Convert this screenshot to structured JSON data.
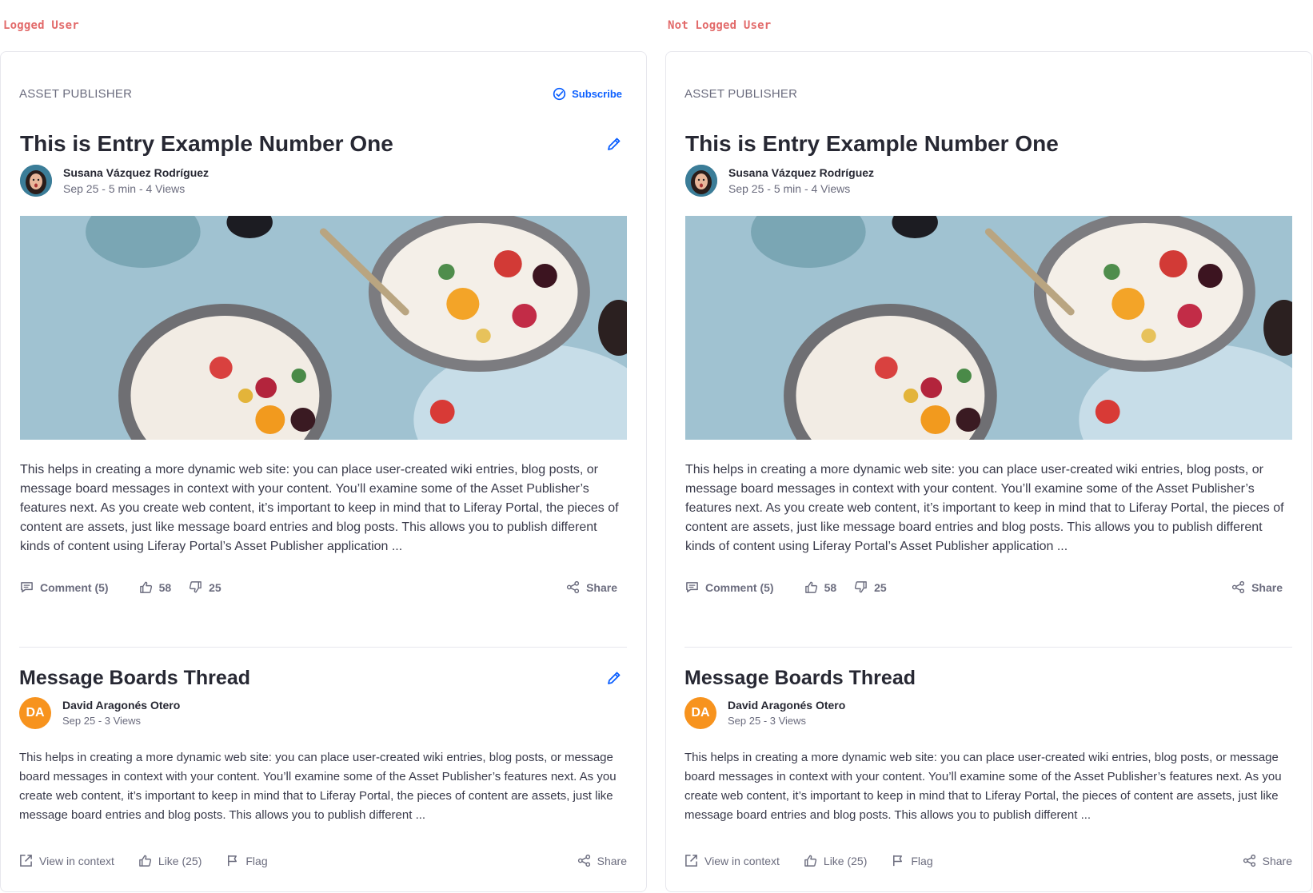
{
  "columns": [
    {
      "tag": "Logged User",
      "card_label": "ASSET PUBLISHER",
      "subscribe_label": "Subscribe",
      "entry": {
        "title": "This is Entry Example Number One",
        "author": "Susana Vázquez Rodríguez",
        "meta": "Sep 25 - 5 min - 4 Views",
        "excerpt": "This helps in creating a more dynamic web site: you can place user-created wiki entries, blog posts, or message board messages in context with your content. You’ll examine some of the Asset Publisher’s features next. As you create web content, it’s important to keep in mind that to Liferay Portal, the pieces of content are assets, just like message board entries and blog posts. This allows you to publish different kinds of content using Liferay Portal’s Asset Publisher application ...",
        "comment_label": "Comment (5)",
        "likes": "58",
        "dislikes": "25",
        "share_label": "Share"
      },
      "thread": {
        "title": "Message Boards Thread",
        "author_initials": "DA",
        "author": "David Aragonés Otero",
        "meta": "Sep 25  -  3 Views",
        "excerpt": "This helps in creating a more dynamic web site: you can place user-created wiki entries, blog posts, or message board messages in context with your content. You’ll examine some of the Asset Publisher’s features next. As you create web content, it’s important to keep in mind that to Liferay Portal, the pieces of content are assets, just like message board entries and blog posts. This allows you to publish different ...",
        "view_label": "View in context",
        "like_label": "Like (25)",
        "flag_label": "Flag",
        "share_label": "Share"
      }
    },
    {
      "tag": "Not Logged User",
      "card_label": "ASSET PUBLISHER",
      "entry": {
        "title": "This is Entry Example Number One",
        "author": "Susana Vázquez Rodríguez",
        "meta": "Sep 25 - 5 min - 4 Views",
        "excerpt": "This helps in creating a more dynamic web site: you can place user-created wiki entries, blog posts, or message board messages in context with your content. You’ll examine some of the Asset Publisher’s features next. As you create web content, it’s important to keep in mind that to Liferay Portal, the pieces of content are assets, just like message board entries and blog posts. This allows you to publish different kinds of content using Liferay Portal’s Asset Publisher application ...",
        "comment_label": "Comment (5)",
        "likes": "58",
        "dislikes": "25",
        "share_label": "Share"
      },
      "thread": {
        "title": "Message Boards Thread",
        "author_initials": "DA",
        "author": "David Aragonés Otero",
        "meta": "Sep 25  -  3 Views",
        "excerpt": "This helps in creating a more dynamic web site: you can place user-created wiki entries, blog posts, or message board messages in context with your content. You’ll examine some of the Asset Publisher’s features next. As you create web content, it’s important to keep in mind that to Liferay Portal, the pieces of content are assets, just like message board entries and blog posts. This allows you to publish different ...",
        "view_label": "View in context",
        "like_label": "Like (25)",
        "flag_label": "Flag",
        "share_label": "Share"
      }
    }
  ],
  "colors": {
    "accent": "#0b5fff",
    "tag": "#e26a6a",
    "avatar_initials_bg": "#f7931e",
    "text_primary": "#272833",
    "text_secondary": "#6b6c7e"
  },
  "icons": [
    "check-circle-icon",
    "pencil-icon",
    "comment-icon",
    "thumbs-up-icon",
    "thumbs-down-icon",
    "share-icon",
    "external-link-icon",
    "flag-icon"
  ]
}
